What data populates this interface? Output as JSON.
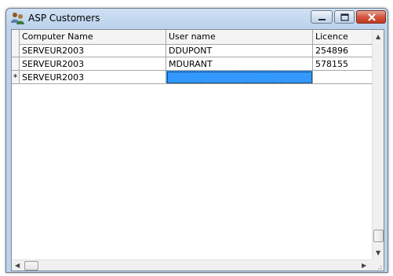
{
  "window": {
    "title": "ASP Customers",
    "icon": "users-icon",
    "controls": [
      "minimize-icon",
      "maximize-icon",
      "close-icon"
    ]
  },
  "grid": {
    "columns": [
      "Computer Name",
      "User name",
      "Licence"
    ],
    "rows": [
      {
        "indicator": "",
        "computer": "SERVEUR2003",
        "user": "DDUPONT",
        "licence": "254896"
      },
      {
        "indicator": "",
        "computer": "SERVEUR2003",
        "user": "MDURANT",
        "licence": "578155"
      },
      {
        "indicator": "*",
        "computer": "SERVEUR2003",
        "user": "",
        "licence": ""
      }
    ]
  },
  "colors": {
    "selection": "#3399ff",
    "close_button": "#c0391f",
    "titlebar": "#cfe0f3"
  }
}
